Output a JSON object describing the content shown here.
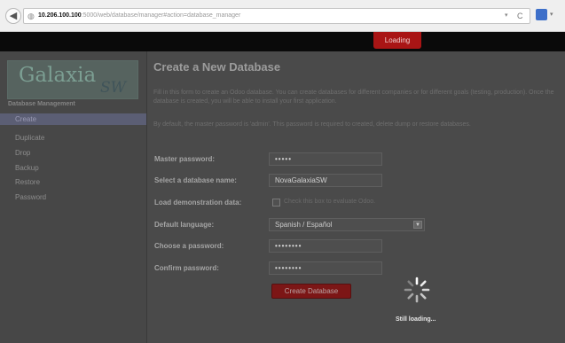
{
  "browser": {
    "site_icon": "globe-icon",
    "url_host": "10.206.100.100",
    "url_path": ":5000/web/database/manager#action=database_manager",
    "dropdown_glyph": "▾",
    "reload_glyph": "C"
  },
  "topbar": {
    "loading_label": "Loading"
  },
  "sidebar": {
    "logo_text": "Galaxia",
    "logo_suffix": "SW",
    "heading": "Database Management",
    "items": [
      {
        "label": "Create",
        "active": true
      },
      {
        "label": "Duplicate",
        "active": false
      },
      {
        "label": "Drop",
        "active": false
      },
      {
        "label": "Backup",
        "active": false
      },
      {
        "label": "Restore",
        "active": false
      },
      {
        "label": "Password",
        "active": false
      }
    ]
  },
  "main": {
    "title": "Create a New Database",
    "intro_1": "Fill in this form to create an Odoo database. You can create databases for different companies or for different goals (testing, production). Once the database is created, you will be able to install your first application.",
    "intro_2": "By default, the master password is 'admin'. This password is required to created, delete dump or restore databases.",
    "form": {
      "master_password": {
        "label": "Master password:",
        "value": "•••••"
      },
      "database_name": {
        "label": "Select a database name:",
        "value": "NovaGalaxiaSW"
      },
      "demo_data": {
        "label": "Load demonstration data:",
        "checked": false,
        "text": "Check this box to evaluate Odoo."
      },
      "language": {
        "label": "Default language:",
        "value": "Spanish / Español"
      },
      "choose_password": {
        "label": "Choose a password:",
        "value": "••••••••"
      },
      "confirm_password": {
        "label": "Confirm password:",
        "value": "••••••••"
      }
    },
    "create_button": "Create Database"
  },
  "overlay": {
    "spinner_icon": "spinner-icon",
    "message": "Still loading..."
  },
  "colors": {
    "brand_red": "#a91515",
    "active_menu": "#5b5e74"
  }
}
